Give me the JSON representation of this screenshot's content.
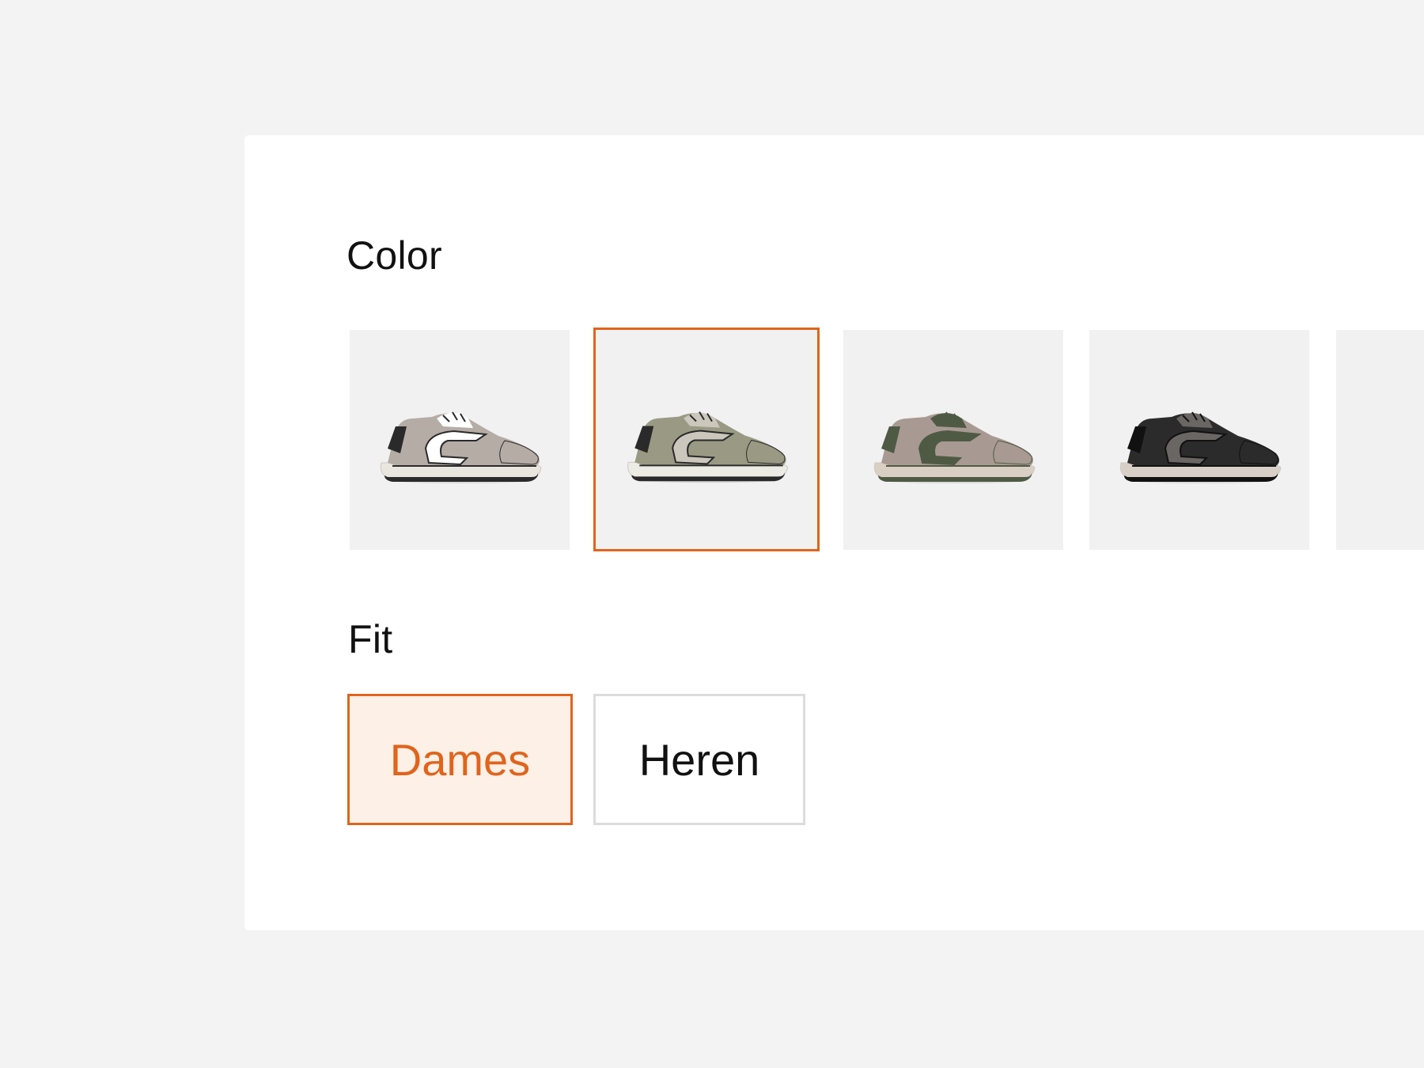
{
  "color_section": {
    "title": "Color",
    "swatches": [
      {
        "icon": "sneaker-grey-white-icon",
        "selected": false,
        "upper": "#b5aca6",
        "accent": "#ffffff",
        "trim": "#2a2a2a",
        "sole": "#e9e6e0"
      },
      {
        "icon": "sneaker-olive-icon",
        "selected": true,
        "upper": "#9a9a84",
        "accent": "#cbc7bd",
        "trim": "#2a2a2a",
        "sole": "#ecebe4"
      },
      {
        "icon": "sneaker-taupe-green-icon",
        "selected": false,
        "upper": "#a89a92",
        "accent": "#4f5a45",
        "trim": "#4f5a45",
        "sole": "#d9cfc3"
      },
      {
        "icon": "sneaker-black-icon",
        "selected": false,
        "upper": "#2c2b2b",
        "accent": "#6a6663",
        "trim": "#111111",
        "sole": "#d8d0c6"
      },
      {
        "icon": "sneaker-stone-icon",
        "selected": false,
        "upper": "#b8b3a8",
        "accent": "#cfcac0",
        "trim": "#9a958b",
        "sole": "#e2ddd3"
      }
    ]
  },
  "fit_section": {
    "title": "Fit",
    "options": [
      {
        "label": "Dames",
        "selected": true
      },
      {
        "label": "Heren",
        "selected": false
      }
    ]
  },
  "colors": {
    "accent": "#e0641c",
    "selected_fill": "#fdf0e7",
    "swatch_bg": "#f1f1f1",
    "page_bg": "#f3f3f3"
  }
}
